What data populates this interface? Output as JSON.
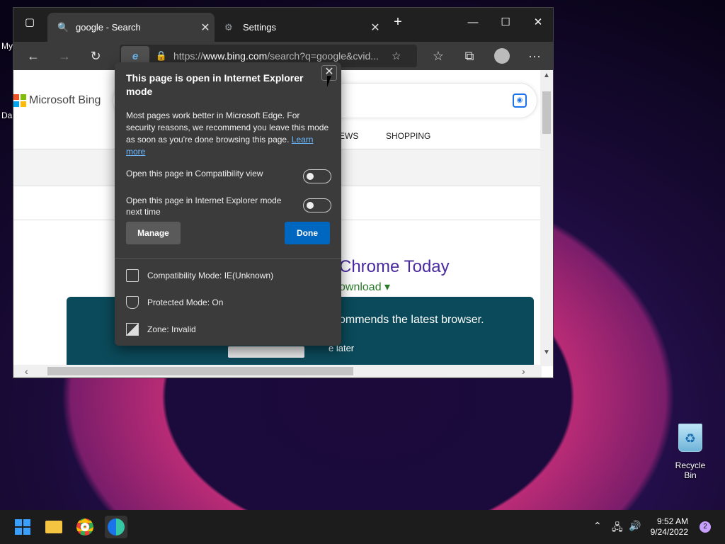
{
  "desktop": {
    "left_labels": [
      "My",
      "Da"
    ],
    "recycle_bin": "Recycle Bin"
  },
  "browser": {
    "tabs": [
      {
        "label": "google - Search",
        "active": true
      },
      {
        "label": "Settings",
        "active": false
      }
    ],
    "new_tab_symbol": "+",
    "url_prefix": "https://",
    "url_host": "www.bing.com",
    "url_rest": "/search?q=google&cvid...",
    "ie_badge": "e"
  },
  "page": {
    "logo_text": "Microsoft Bing",
    "nav": [
      "EWS",
      "SHOPPING"
    ],
    "ad_title": "Chrome Today",
    "ad_download": "ownload ▾",
    "banner_msg": "ommends the latest browser.",
    "banner_later": "e later"
  },
  "popup": {
    "title": "This page is open in Internet Explorer mode",
    "body": "Most pages work better in Microsoft Edge. For security reasons, we recommend you leave this mode as soon as you're done browsing this page.",
    "learn_more": "Learn more",
    "toggle1": "Open this page in Compatibility view",
    "toggle2": "Open this page in Internet Explorer mode next time",
    "manage": "Manage",
    "done": "Done",
    "compat_mode": "Compatibility Mode: IE(Unknown)",
    "protected_mode": "Protected Mode: On",
    "zone": "Zone: Invalid"
  },
  "taskbar": {
    "time": "9:52 AM",
    "date": "9/24/2022",
    "notifications": "2"
  }
}
